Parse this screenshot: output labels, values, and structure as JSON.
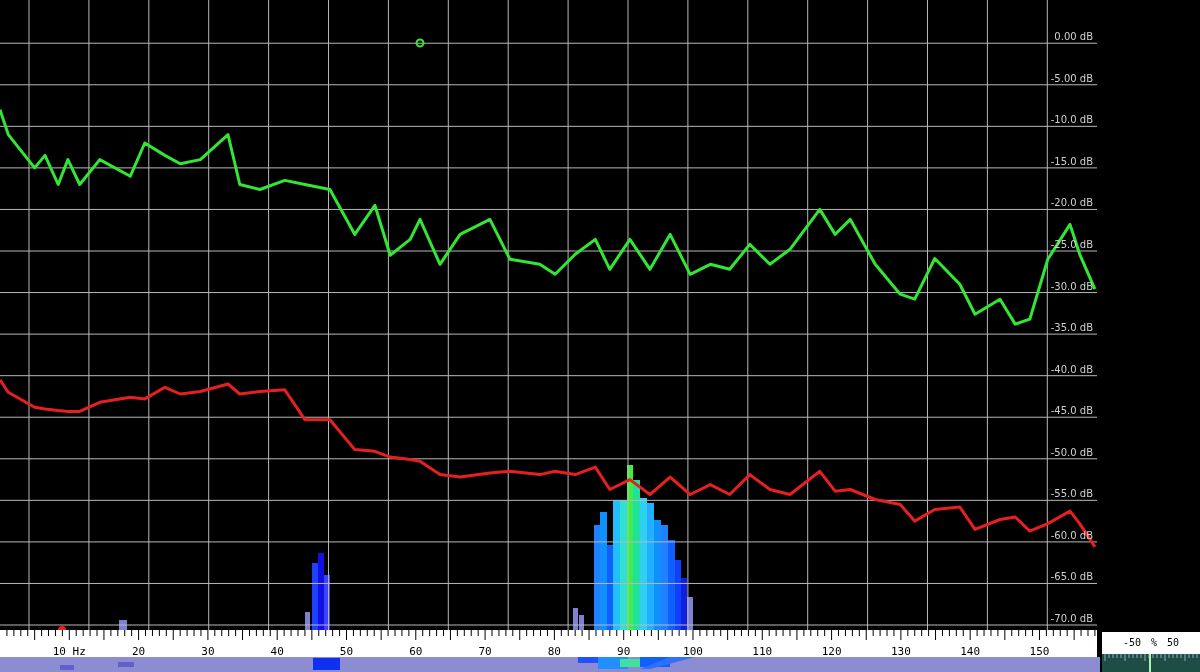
{
  "spectrum": {
    "chart_data": {
      "type": "line",
      "grid": true,
      "xlim": [
        0,
        158.3
      ],
      "ylim": [
        -70.6,
        5.2
      ],
      "x": [
        0,
        1.2,
        5,
        6.5,
        8.4,
        9.8,
        11.5,
        14.4,
        18.8,
        20.9,
        23.8,
        26,
        28.9,
        32.9,
        34.6,
        37.5,
        41.1,
        44,
        47.6,
        51.2,
        54.1,
        56.3,
        59.2,
        60.6,
        63.5,
        66.4,
        70.7,
        73.6,
        77.9,
        80.1,
        83,
        85.9,
        88,
        90.9,
        93.8,
        96.7,
        99.6,
        102.5,
        105.3,
        108.2,
        111.1,
        114,
        118.3,
        120.5,
        122.7,
        126.3,
        129.9,
        132,
        134.9,
        138.5,
        140.7,
        144.3,
        146.5,
        148.6,
        151.2,
        154.4,
        155.8,
        158
      ],
      "series": [
        {
          "color": "#33e633",
          "values": [
            -8,
            -11,
            -15,
            -13.5,
            -17,
            -14,
            -17,
            -14,
            -16,
            -12,
            -13.5,
            -14.5,
            -14,
            -11,
            -17,
            -17.6,
            -16.5,
            -17,
            -17.6,
            -23,
            -19.5,
            -25.5,
            -23.6,
            -21.2,
            -26.6,
            -23,
            -21.2,
            -26,
            -26.6,
            -27.8,
            -25.4,
            -23.6,
            -27.2,
            -23.6,
            -27.2,
            -23,
            -27.8,
            -26.6,
            -27.2,
            -24.2,
            -26.6,
            -24.8,
            -20,
            -23,
            -21.2,
            -26.6,
            -30.2,
            -30.8,
            -25.9,
            -29,
            -32.6,
            -30.8,
            -33.8,
            -33.2,
            -26,
            -21.8,
            -25.4,
            -29.6
          ]
        },
        {
          "color": "#e62020",
          "values": [
            -40.5,
            -42,
            -43.8,
            -44,
            -44.2,
            -44.3,
            -44.3,
            -43.2,
            -42.6,
            -42.8,
            -41.4,
            -42.2,
            -41.9,
            -41,
            -42.2,
            -41.9,
            -41.7,
            -45.3,
            -45.3,
            -48.9,
            -49.1,
            -49.8,
            -50.1,
            -50.3,
            -51.9,
            -52.2,
            -51.7,
            -51.5,
            -51.9,
            -51.5,
            -51.9,
            -51,
            -53.7,
            -52.5,
            -54.3,
            -52.2,
            -54.3,
            -53.1,
            -54.3,
            -51.9,
            -53.7,
            -54.3,
            -51.5,
            -53.9,
            -53.7,
            -54.9,
            -55.5,
            -57.5,
            -56.1,
            -55.8,
            -58.5,
            -57.3,
            -57,
            -58.7,
            -57.8,
            -56.3,
            -57.8,
            -60.6
          ]
        }
      ],
      "yticks": [
        {
          "value": 0,
          "label": "0.00 dB"
        },
        {
          "value": -5,
          "label": "-5.00 dB"
        },
        {
          "value": -10,
          "label": "-10.0 dB"
        },
        {
          "value": -15,
          "label": "-15.0 dB"
        },
        {
          "value": -20,
          "label": "-20.0 dB"
        },
        {
          "value": -25,
          "label": "-25.0 dB"
        },
        {
          "value": -30,
          "label": "-30.0 dB"
        },
        {
          "value": -35,
          "label": "-35.0 dB"
        },
        {
          "value": -40,
          "label": "-40.0 dB"
        },
        {
          "value": -45,
          "label": "-45.0 dB"
        },
        {
          "value": -50,
          "label": "-50.0 dB"
        },
        {
          "value": -55,
          "label": "-55.0 dB"
        },
        {
          "value": -60,
          "label": "-60.0 dB"
        },
        {
          "value": -65,
          "label": "-65.0 dB"
        },
        {
          "value": -70,
          "label": "-70.0 dB"
        }
      ],
      "xticks": [
        {
          "value": 10,
          "label": "10 Hz"
        },
        20,
        30,
        40,
        50,
        60,
        70,
        80,
        90,
        100,
        110,
        120,
        130,
        140,
        150
      ]
    }
  },
  "balance_meter": {
    "labels": [
      "-50",
      "%",
      "50"
    ]
  }
}
